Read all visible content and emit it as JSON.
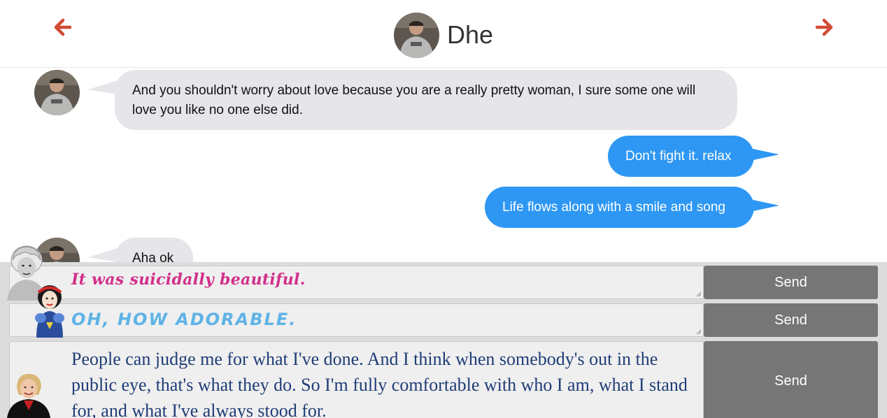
{
  "header": {
    "contact_name": "Dhe",
    "prev_icon": "arrow-left-icon",
    "next_icon": "arrow-right-icon",
    "accent_color": "#d14b35"
  },
  "messages": [
    {
      "direction": "incoming",
      "text": "And you shouldn't worry about love because you are a really pretty woman, I sure some one will love you like no one else did."
    },
    {
      "direction": "outgoing",
      "text": "Don't fight it. relax"
    },
    {
      "direction": "outgoing",
      "text": "Life flows along with a smile and song"
    },
    {
      "direction": "incoming",
      "text": "Aha ok"
    }
  ],
  "suggestions": [
    {
      "text": "It was suicidally beautiful.",
      "send_label": "Send",
      "avatar": "marilyn-monroe-avatar"
    },
    {
      "text": "OH, HOW ADORABLE.",
      "send_label": "Send",
      "avatar": "snow-white-avatar"
    },
    {
      "text": "People can judge me for what I've done. And I think when somebody's out in the public eye, that's what they do. So I'm fully comfortable with who I am, what I stand for, and what I've always stood for.",
      "send_label": "Send",
      "avatar": "hillary-clinton-avatar"
    }
  ],
  "colors": {
    "incoming_bubble": "#e5e5ea",
    "outgoing_bubble": "#2d97f3",
    "send_button": "#767676"
  }
}
